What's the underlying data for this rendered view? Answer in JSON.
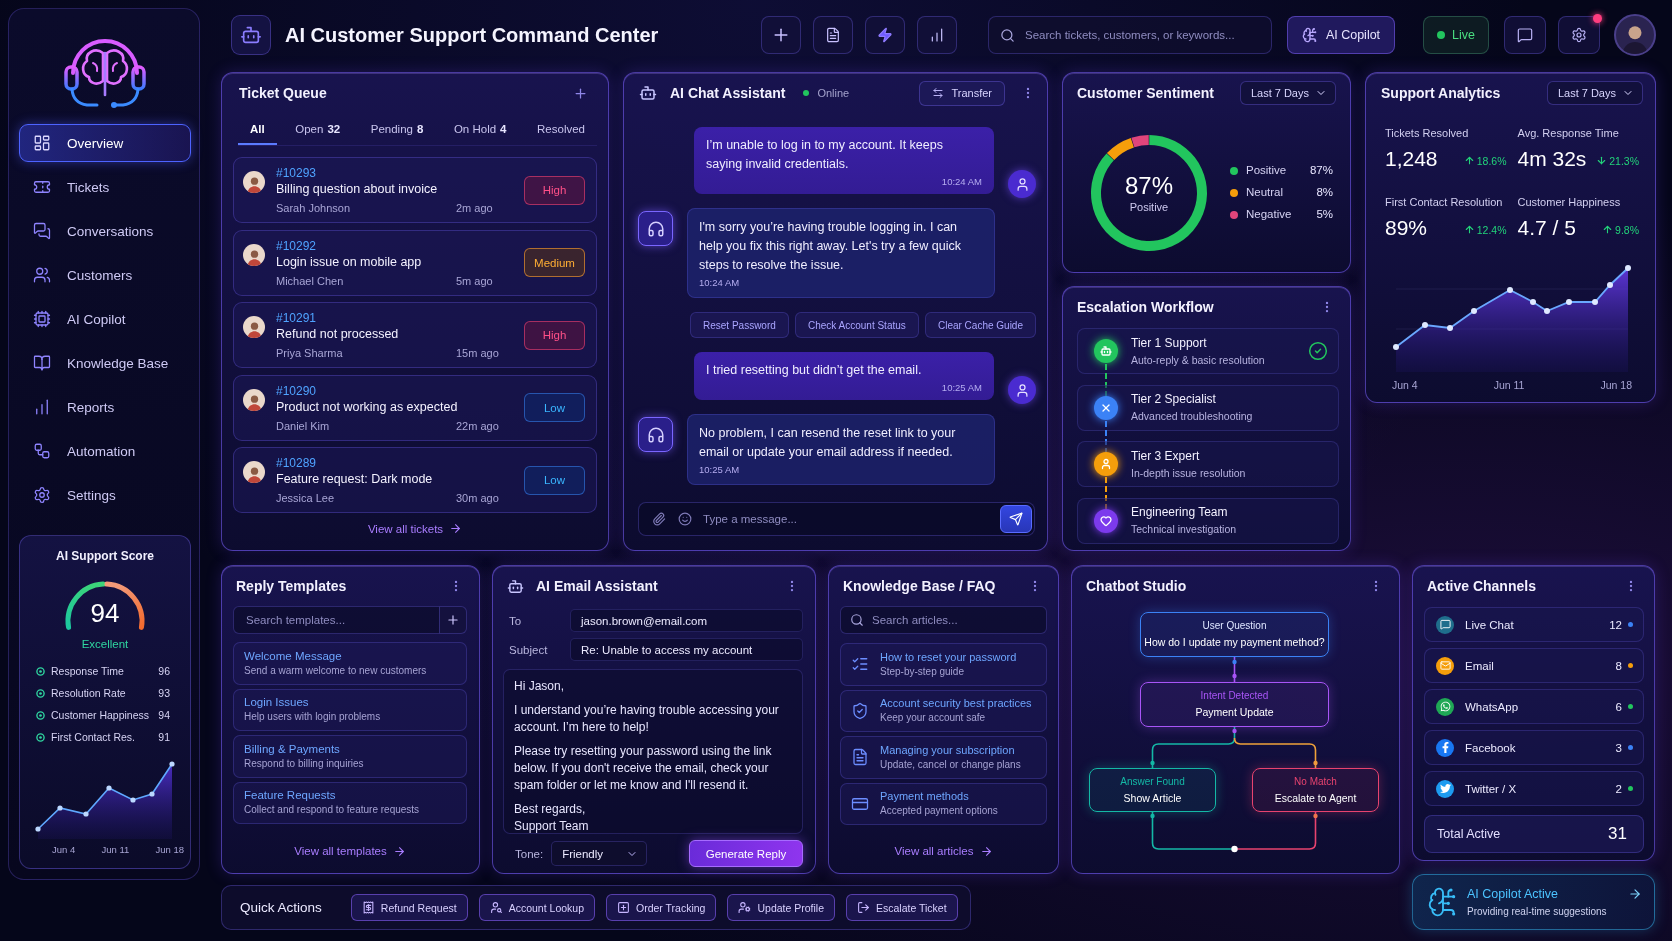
{
  "topbar": {
    "title": "AI Customer Support Command Center",
    "search": {
      "placeholder": "Search tickets, customers, or keywords..."
    },
    "copilot_button": "AI Copilot",
    "live": {
      "label": "Live",
      "on": true
    },
    "notification": true
  },
  "sidebar": {
    "nav": [
      {
        "label": "Overview",
        "selected": true
      },
      {
        "label": "Tickets",
        "selected": false
      },
      {
        "label": "Conversations",
        "selected": false
      },
      {
        "label": "Customers",
        "selected": false
      },
      {
        "label": "AI Copilot",
        "selected": false
      },
      {
        "label": "Knowledge Base",
        "selected": false
      },
      {
        "label": "Reports",
        "selected": false
      },
      {
        "label": "Automation",
        "selected": false
      },
      {
        "label": "Settings",
        "selected": false
      }
    ],
    "score_card": {
      "title": "AI Support Score",
      "score": "94",
      "rating": "Excellent",
      "metrics": [
        {
          "label": "Response Time",
          "value": "96"
        },
        {
          "label": "Resolution Rate",
          "value": "93"
        },
        {
          "label": "Customer Happiness",
          "value": "94"
        },
        {
          "label": "First Contact Res.",
          "value": "91"
        }
      ],
      "x_labels": [
        "Jun 4",
        "Jun 11",
        "Jun 18"
      ]
    }
  },
  "ticket_queue": {
    "title": "Ticket Queue",
    "tabs": [
      {
        "label": "All",
        "selected": true
      },
      {
        "label": "Open",
        "count": "32",
        "selected": false
      },
      {
        "label": "Pending",
        "count": "8",
        "selected": false
      },
      {
        "label": "On Hold",
        "count": "4",
        "selected": false
      },
      {
        "label": "Resolved",
        "selected": false
      }
    ],
    "tickets": [
      {
        "id": "#10293",
        "subject": "Billing question about invoice",
        "customer": "Sarah Johnson",
        "time": "2m ago",
        "priority": {
          "label": "High",
          "kind": "high"
        }
      },
      {
        "id": "#10292",
        "subject": "Login issue on mobile app",
        "customer": "Michael Chen",
        "time": "5m ago",
        "priority": {
          "label": "Medium",
          "kind": "medium"
        }
      },
      {
        "id": "#10291",
        "subject": "Refund not processed",
        "customer": "Priya Sharma",
        "time": "15m ago",
        "priority": {
          "label": "High",
          "kind": "high"
        }
      },
      {
        "id": "#10290",
        "subject": "Product not working as expected",
        "customer": "Daniel Kim",
        "time": "22m ago",
        "priority": {
          "label": "Low",
          "kind": "low"
        }
      },
      {
        "id": "#10289",
        "subject": "Feature request: Dark mode",
        "customer": "Jessica Lee",
        "time": "30m ago",
        "priority": {
          "label": "Low",
          "kind": "low"
        }
      }
    ],
    "link": "View all tickets"
  },
  "chat": {
    "title": "AI Chat Assistant",
    "status": {
      "label": "Online",
      "online": true
    },
    "transfer_button": "Transfer",
    "thread": [
      {
        "kind": "user",
        "text": "I’m unable to log in to my account. It keeps saying invalid credentials.",
        "time": "10:24 AM"
      },
      {
        "kind": "bot",
        "text": "I'm sorry you’re having trouble logging in. I can help you fix this right away. Let's try a few quick steps to resolve the issue.",
        "time": "10:24 AM"
      },
      {
        "kind": "suggestions",
        "options": [
          "Reset Password",
          "Check Account Status",
          "Clear Cache Guide"
        ]
      },
      {
        "kind": "user",
        "text": "I tried resetting but didn’t get the email.",
        "time": "10:25 AM"
      },
      {
        "kind": "bot",
        "text": "No problem, I can resend the reset link to your email or update your email address if needed.",
        "time": "10:25 AM"
      }
    ],
    "input": {
      "placeholder": "Type a message..."
    }
  },
  "sentiment": {
    "title": "Customer Sentiment",
    "range": "Last 7 Days",
    "center_value": "87%",
    "center_label": "Positive",
    "chart_data": {
      "type": "donut",
      "categories": [
        "Positive",
        "Neutral",
        "Negative"
      ],
      "values": [
        87,
        8,
        5
      ]
    },
    "legend": [
      {
        "value": "87%",
        "color": "#22c55e"
      },
      {
        "value": "8%",
        "color": "#f59e0b"
      },
      {
        "value": "5%",
        "color": "#e0457b"
      }
    ]
  },
  "analytics": {
    "title": "Support Analytics",
    "range": "Last 7 Days",
    "stats": [
      {
        "label": "Tickets Resolved",
        "value": "1,248",
        "change": "18.6%",
        "kind": "up"
      },
      {
        "label": "Avg. Response Time",
        "value": "4m 32s",
        "change": "21.3%",
        "kind": "down"
      },
      {
        "label": "First Contact Resolution",
        "value": "89%",
        "change": "12.4%",
        "kind": "up"
      },
      {
        "label": "Customer Happiness",
        "value": "4.7 / 5",
        "change": "9.8%",
        "kind": "up"
      }
    ],
    "x_labels": [
      "Jun 4",
      "Jun 11",
      "Jun 18"
    ]
  },
  "escalation": {
    "title": "Escalation Workflow",
    "steps": [
      {
        "title": "Tier 1 Support",
        "subtitle": "Auto-reply & basic resolution",
        "color": "#22c55e",
        "done": true
      },
      {
        "title": "Tier 2 Specialist",
        "subtitle": "Advanced troubleshooting",
        "color": "#3b82f6",
        "done": false
      },
      {
        "title": "Tier 3 Expert",
        "subtitle": "In-depth issue resolution",
        "color": "#f59e0b",
        "done": false
      },
      {
        "title": "Engineering Team",
        "subtitle": "Technical investigation",
        "color": "#7c3aed",
        "done": false
      }
    ]
  },
  "reply_templates": {
    "title": "Reply Templates",
    "search": {
      "placeholder": "Search templates..."
    },
    "templates": [
      {
        "title": "Welcome Message",
        "description": "Send a warm welcome to new customers"
      },
      {
        "title": "Login Issues",
        "description": "Help users with login problems"
      },
      {
        "title": "Billing & Payments",
        "description": "Respond to billing inquiries"
      },
      {
        "title": "Feature Requests",
        "description": "Collect and respond to feature requests"
      }
    ],
    "link": "View all templates"
  },
  "email_assistant": {
    "title": "AI Email Assistant",
    "fields": [
      {
        "label": "To",
        "value": "jason.brown@email.com"
      },
      {
        "label": "Subject",
        "value": "Re: Unable to access my account"
      }
    ],
    "body": [
      "Hi Jason,",
      "I understand you’re having trouble accessing your account. I’m here to help!",
      "Please try resetting your password using the link below. If you don't receive the email, check your spam folder or let me know and I'll resend it."
    ],
    "signature": [
      "Best regards,",
      "Support Team"
    ],
    "tone": {
      "label": "Tone:",
      "value": "Friendly"
    },
    "button": "Generate Reply"
  },
  "knowledge_base": {
    "title": "Knowledge Base / FAQ",
    "search": {
      "placeholder": "Search articles..."
    },
    "articles": [
      {
        "title": "How to reset your password",
        "description": "Step-by-step guide"
      },
      {
        "title": "Account security best practices",
        "description": "Keep your account safe"
      },
      {
        "title": "Managing your subscription",
        "description": "Update, cancel or change plans"
      },
      {
        "title": "Payment methods",
        "description": "Accepted payment options"
      }
    ],
    "link": "View all articles"
  },
  "chatbot_studio": {
    "title": "Chatbot Studio",
    "nodes": [
      {
        "label": "User Question",
        "text": "How do I update my payment method?",
        "color": "#3b82f6"
      },
      {
        "label": "Intent Detected",
        "text": "Payment Update",
        "color": "#a855f7"
      },
      {
        "label": "Answer Found",
        "text": "Show Article",
        "color": "#14b8a6"
      },
      {
        "label": "No Match",
        "text": "Escalate to Agent",
        "color": "#e8436f"
      }
    ]
  },
  "active_channels": {
    "title": "Active Channels",
    "channels": [
      {
        "name": "Live Chat",
        "count": "12",
        "color": "#3b82f6"
      },
      {
        "name": "Email",
        "count": "8",
        "color": "#f59e0b"
      },
      {
        "name": "WhatsApp",
        "count": "6",
        "color": "#22c55e"
      },
      {
        "name": "Facebook",
        "count": "3",
        "color": "#3b82f6"
      },
      {
        "name": "Twitter / X",
        "count": "2",
        "color": "#22c55e"
      }
    ],
    "total": {
      "label": "Total Active",
      "value": "31"
    }
  },
  "copilot_status": {
    "title": "AI Copilot Active",
    "subtitle": "Providing real-time suggestions"
  },
  "quick_actions": {
    "title": "Quick Actions",
    "actions": [
      "Refund Request",
      "Account Lookup",
      "Order Tracking",
      "Update Profile",
      "Escalate Ticket"
    ]
  }
}
